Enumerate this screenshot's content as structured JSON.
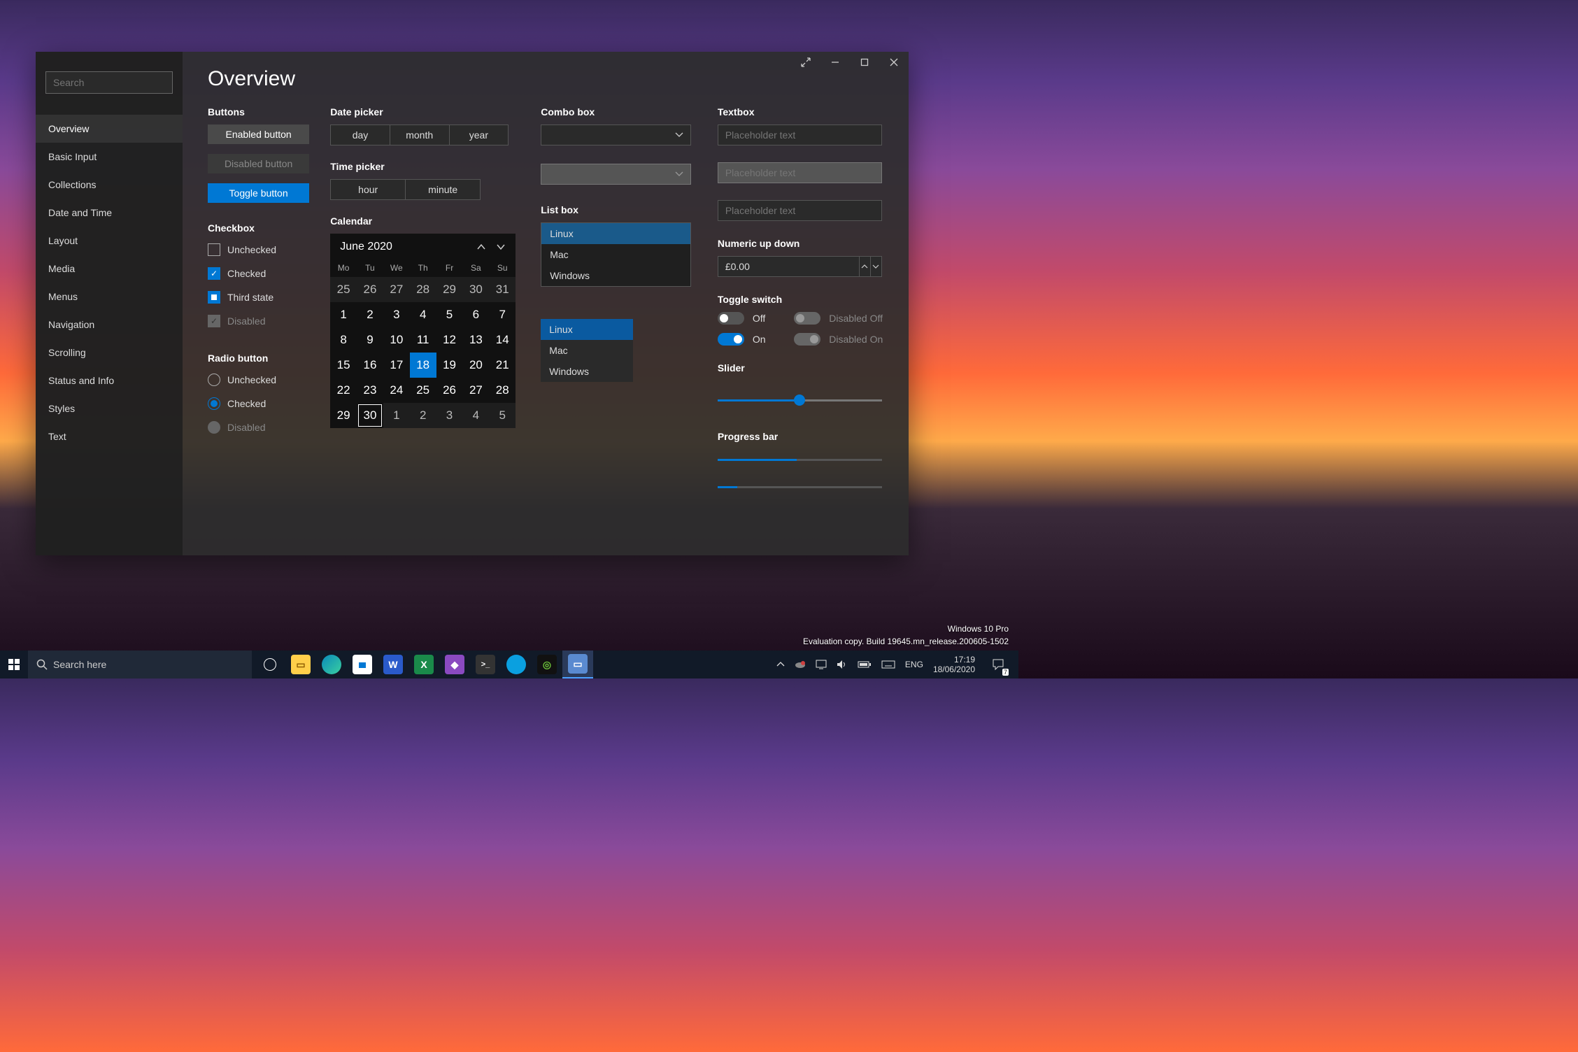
{
  "sidebar": {
    "search_placeholder": "Search",
    "items": [
      {
        "label": "Overview",
        "active": true
      },
      {
        "label": "Basic Input"
      },
      {
        "label": "Collections"
      },
      {
        "label": "Date and Time"
      },
      {
        "label": "Layout"
      },
      {
        "label": "Media"
      },
      {
        "label": "Menus"
      },
      {
        "label": "Navigation"
      },
      {
        "label": "Scrolling"
      },
      {
        "label": "Status and Info"
      },
      {
        "label": "Styles"
      },
      {
        "label": "Text"
      }
    ]
  },
  "page_title": "Overview",
  "buttons": {
    "section": "Buttons",
    "enabled": "Enabled button",
    "disabled": "Disabled button",
    "toggle": "Toggle button"
  },
  "checkbox": {
    "section": "Checkbox",
    "opts": [
      "Unchecked",
      "Checked",
      "Third state",
      "Disabled"
    ]
  },
  "radio": {
    "section": "Radio button",
    "opts": [
      "Unchecked",
      "Checked",
      "Disabled"
    ]
  },
  "datepicker": {
    "section": "Date picker",
    "day": "day",
    "month": "month",
    "year": "year"
  },
  "timepicker": {
    "section": "Time picker",
    "hour": "hour",
    "minute": "minute"
  },
  "calendar": {
    "section": "Calendar",
    "header": "June 2020",
    "dow": [
      "Mo",
      "Tu",
      "We",
      "Th",
      "Fr",
      "Sa",
      "Su"
    ],
    "days": [
      {
        "n": 25,
        "o": true
      },
      {
        "n": 26,
        "o": true
      },
      {
        "n": 27,
        "o": true
      },
      {
        "n": 28,
        "o": true
      },
      {
        "n": 29,
        "o": true
      },
      {
        "n": 30,
        "o": true
      },
      {
        "n": 31,
        "o": true
      },
      {
        "n": 1
      },
      {
        "n": 2
      },
      {
        "n": 3
      },
      {
        "n": 4
      },
      {
        "n": 5
      },
      {
        "n": 6
      },
      {
        "n": 7
      },
      {
        "n": 8
      },
      {
        "n": 9
      },
      {
        "n": 10
      },
      {
        "n": 11
      },
      {
        "n": 12
      },
      {
        "n": 13
      },
      {
        "n": 14
      },
      {
        "n": 15
      },
      {
        "n": 16
      },
      {
        "n": 17
      },
      {
        "n": 18,
        "sel": true
      },
      {
        "n": 19
      },
      {
        "n": 20
      },
      {
        "n": 21
      },
      {
        "n": 22
      },
      {
        "n": 23
      },
      {
        "n": 24
      },
      {
        "n": 25
      },
      {
        "n": 26
      },
      {
        "n": 27
      },
      {
        "n": 28
      },
      {
        "n": 29
      },
      {
        "n": 30,
        "today": true
      },
      {
        "n": 1,
        "o": true
      },
      {
        "n": 2,
        "o": true
      },
      {
        "n": 3,
        "o": true
      },
      {
        "n": 4,
        "o": true
      },
      {
        "n": 5,
        "o": true
      }
    ]
  },
  "combo": {
    "section": "Combo box"
  },
  "listbox": {
    "section": "List box",
    "items": [
      "Linux",
      "Mac",
      "Windows"
    ],
    "selected": "Linux"
  },
  "textbox": {
    "section": "Textbox",
    "placeholder": "Placeholder text"
  },
  "numeric": {
    "section": "Numeric up down",
    "value": "£0.00"
  },
  "toggle": {
    "section": "Toggle switch",
    "off": "Off",
    "on": "On",
    "doff": "Disabled Off",
    "don": "Disabled On"
  },
  "slider": {
    "section": "Slider",
    "value": 50
  },
  "progress": {
    "section": "Progress bar",
    "p1": 48,
    "p2": 12
  },
  "watermark": {
    "line1": "Windows 10 Pro",
    "line2": "Evaluation copy. Build 19645.mn_release.200605-1502"
  },
  "taskbar": {
    "search_placeholder": "Search here",
    "lang": "ENG",
    "time": "17:19",
    "date": "18/06/2020",
    "action_count": "7"
  }
}
